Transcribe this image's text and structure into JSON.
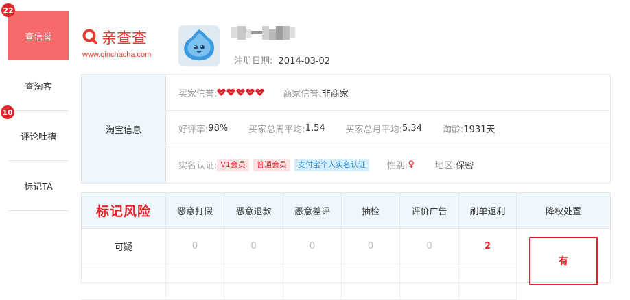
{
  "sidebar": {
    "items": [
      {
        "label": "查信誉",
        "badge": "22"
      },
      {
        "label": "查淘客"
      },
      {
        "label": "评论吐槽",
        "badge": "10"
      },
      {
        "label": "标记TA"
      }
    ]
  },
  "brand": {
    "name": "亲查查",
    "url": "www.qinchacha.com",
    "color": "#e63a2e"
  },
  "profile": {
    "reg_label": "注册日期:",
    "reg_date": "2014-03-02"
  },
  "taobao": {
    "label": "淘宝信息",
    "buyer_credit_label": "买家信誉:",
    "buyer_credit_icon": "heart-icon",
    "buyer_credit_hearts": 5,
    "seller_credit_label": "商家信誉:",
    "seller_credit_value": "非商家",
    "good_rate_label": "好评率:",
    "good_rate_value": "98%",
    "week_avg_label": "买家总周平均:",
    "week_avg_value": "1.54",
    "month_avg_label": "买家总月平均:",
    "month_avg_value": "5.34",
    "age_label": "淘龄:",
    "age_value": "1931天",
    "verify_label": "实名认证:",
    "verify_tags": [
      "V1会员",
      "普通会员",
      "支付宝个人实名认证"
    ],
    "gender_label": "性别:",
    "gender_value": "♀",
    "region_label": "地区:",
    "region_value": "保密"
  },
  "risk": {
    "title": "标记风险",
    "columns": [
      "恶意打假",
      "恶意退款",
      "恶意差评",
      "抽检",
      "评价广告",
      "刷单返利",
      "降权处置"
    ],
    "rows": [
      {
        "label": "可疑",
        "values": [
          "0",
          "0",
          "0",
          "0",
          "0",
          "2"
        ]
      }
    ],
    "penalty": "有"
  }
}
